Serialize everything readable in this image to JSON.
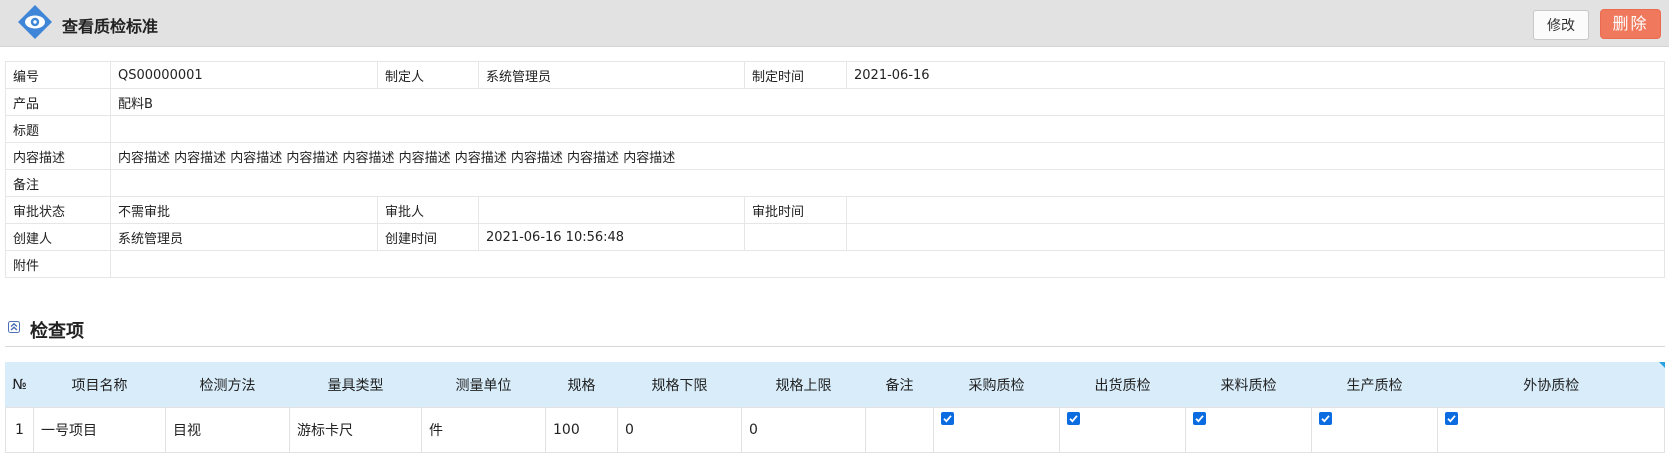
{
  "header": {
    "title": "查看质检标准",
    "edit_label": "修改",
    "delete_label": "删除"
  },
  "details": {
    "code_label": "编号",
    "code_value": "QS00000001",
    "maker_label": "制定人",
    "maker_value": "系统管理员",
    "make_time_label": "制定时间",
    "make_time_value": "2021-06-16",
    "product_label": "产品",
    "product_value": "配料B",
    "subject_label": "标题",
    "subject_value": "",
    "content_label": "内容描述",
    "content_value": "内容描述 内容描述 内容描述 内容描述 内容描述 内容描述 内容描述 内容描述 内容描述 内容描述",
    "remark_label": "备注",
    "remark_value": "",
    "approval_status_label": "审批状态",
    "approval_status_value": "不需审批",
    "approver_label": "审批人",
    "approver_value": "",
    "approval_time_label": "审批时间",
    "approval_time_value": "",
    "creator_label": "创建人",
    "creator_value": "系统管理员",
    "create_time_label": "创建时间",
    "create_time_value": "2021-06-16 10:56:48",
    "attachment_label": "附件",
    "attachment_value": ""
  },
  "section": {
    "title": "检查项"
  },
  "items_table": {
    "columns": [
      "№",
      "项目名称",
      "检测方法",
      "量具类型",
      "测量单位",
      "规格",
      "规格下限",
      "规格上限",
      "备注",
      "采购质检",
      "出货质检",
      "来料质检",
      "生产质检",
      "外协质检"
    ],
    "rows": [
      {
        "no": "1",
        "name": "一号项目",
        "method": "目视",
        "gauge": "游标卡尺",
        "unit": "件",
        "spec": "100",
        "lower": "0",
        "upper": "0",
        "remark": "",
        "purchase_qc": true,
        "shipment_qc": true,
        "incoming_qc": true,
        "production_qc": true,
        "outsource_qc": true
      }
    ]
  },
  "colors": {
    "delete_button": "#f0785c",
    "header_bg": "#e2e2e2",
    "table_header_bg": "#d8ecfa",
    "checkbox": "#0a6ce0"
  }
}
